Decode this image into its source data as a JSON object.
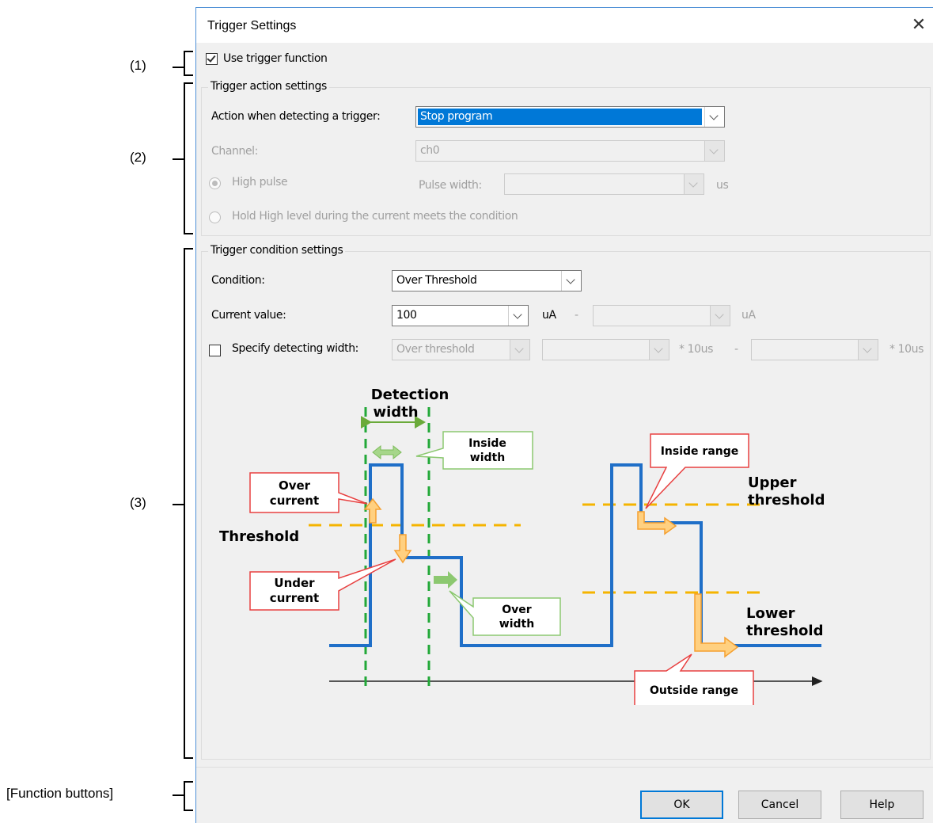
{
  "callouts": {
    "c1": "(1)",
    "c2": "(2)",
    "c3": "(3)",
    "func": "[Function buttons]"
  },
  "dialog": {
    "title": "Trigger Settings",
    "close_glyph": "✕",
    "use_trigger": {
      "label": "Use trigger function",
      "checked": true
    },
    "action_group": {
      "title": "Trigger action settings",
      "action_label": "Action when detecting a trigger:",
      "action_value": "Stop program",
      "channel_label": "Channel:",
      "channel_value": "ch0",
      "high_pulse_label": "High pulse",
      "pulse_width_label": "Pulse width:",
      "pulse_width_value": "",
      "pulse_width_unit": "us",
      "hold_label": "Hold High level during the current meets the condition"
    },
    "condition_group": {
      "title": "Trigger condition settings",
      "condition_label": "Condition:",
      "condition_value": "Over Threshold",
      "current_label": "Current value:",
      "current_value": "100",
      "current_unit": "uA",
      "dash": "-",
      "current_upper_value": "",
      "current_upper_unit": "uA",
      "width_label": "Specify detecting width:",
      "width_checked": false,
      "width_mode_value": "Over threshold",
      "width_from_value": "",
      "width_unit_1": "* 10us",
      "width_to_value": "",
      "width_unit_2": "* 10us"
    },
    "diagram": {
      "detection_width": [
        "Detection",
        "width"
      ],
      "inside_width": [
        "Inside",
        "width"
      ],
      "inside_range": "Inside range",
      "upper_threshold": [
        "Upper",
        "threshold"
      ],
      "over_current": [
        "Over",
        "current"
      ],
      "threshold": "Threshold",
      "under_current": [
        "Under",
        "current"
      ],
      "over_width": [
        "Over",
        "width"
      ],
      "lower_threshold": [
        "Lower",
        "threshold"
      ],
      "outside_range": "Outside range",
      "colors": {
        "signal": "#1f6fc8",
        "threshold": "#f5b400",
        "detection": "#22a838",
        "callout_red": "#e84040",
        "callout_green": "#8cc870",
        "arrow_orange": "#ffd080"
      }
    },
    "buttons": {
      "ok": "OK",
      "cancel": "Cancel",
      "help": "Help"
    }
  }
}
